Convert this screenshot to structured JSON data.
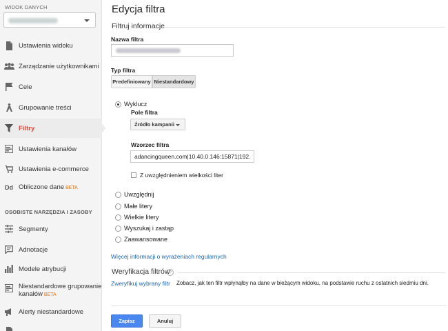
{
  "sidebar": {
    "view_label": "WIDOK DANYCH",
    "items": [
      {
        "label": "Ustawienia widoku",
        "icon": "document-icon"
      },
      {
        "label": "Zarządzanie użytkownikami",
        "icon": "users-icon"
      },
      {
        "label": "Cele",
        "icon": "flag-icon"
      },
      {
        "label": "Grupowanie treści",
        "icon": "person-walk-icon"
      },
      {
        "label": "Filtry",
        "icon": "filter-icon"
      },
      {
        "label": "Ustawienia kanałów",
        "icon": "channels-icon"
      },
      {
        "label": "Ustawienia e-commerce",
        "icon": "cart-icon"
      },
      {
        "label": "Obliczone dane",
        "icon": "dd-icon",
        "badge": "BETA"
      }
    ],
    "tools_label": "OSOBISTE NARZĘDZIA I ZASOBY",
    "tools": [
      {
        "label": "Segmenty",
        "icon": "segments-icon"
      },
      {
        "label": "Adnotacje",
        "icon": "annotation-icon"
      },
      {
        "label": "Modele atrybucji",
        "icon": "bar-chart-icon"
      },
      {
        "label": "Niestandardowe grupowanie",
        "label2": "kanałów",
        "badge": "BETA",
        "icon": "custom-channels-icon"
      },
      {
        "label": "Alerty niestandardowe",
        "icon": "megaphone-icon"
      }
    ]
  },
  "main": {
    "title": "Edycja filtra",
    "section_info": "Filtruj informacje",
    "filter_name_label": "Nazwa filtra",
    "filter_type_label": "Typ filtra",
    "tabs": [
      "Predefiniowany",
      "Niestandardowy"
    ],
    "exclude_label": "Wyklucz",
    "field_label": "Pole filtra",
    "field_value": "Źródło kampanii",
    "pattern_label": "Wzorzec filtra",
    "pattern_value": "adancingqueen.com|10.40.0.146:15871|192.1",
    "case_label": "Z uwzględnieniem wielkości liter",
    "options": [
      "Uwzględnij",
      "Małe litery",
      "Wielkie litery",
      "Wyszukaj i zastąp",
      "Zaawansowane"
    ],
    "regex_link": "Więcej informacji o wyrażeniach regularnych",
    "verify_head": "Weryfikacja filtrów",
    "verify_link": "Zweryfikuj wybrany filtr",
    "verify_desc": "Zobacz, jak ten filtr wpłynąłby na dane w bieżącym widoku, na podstawie ruchu z ostatnich siedmiu dni.",
    "save": "Zapisz",
    "cancel": "Anuluj"
  },
  "colors": {
    "active": "#d94c3d",
    "link": "#1a65b5",
    "primary": "#4a87ee"
  }
}
